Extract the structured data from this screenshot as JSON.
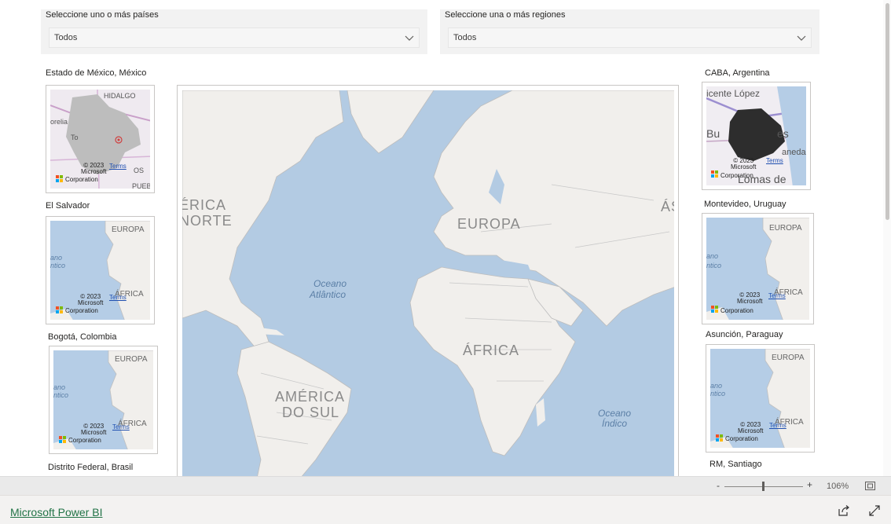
{
  "filters": {
    "countries": {
      "title": "Seleccione uno o más países",
      "value": "Todos"
    },
    "regions": {
      "title": "Seleccione una o más regiones",
      "value": "Todos"
    }
  },
  "visuals": {
    "left": [
      {
        "title": "Estado de México, México",
        "labels": [
          "HIDALGO",
          "orelia",
          "To",
          "OS",
          "PUEB"
        ]
      },
      {
        "title": "El Salvador",
        "labels": [
          "EUROPA",
          "ano",
          "ntico",
          "ÁFRICA"
        ]
      },
      {
        "title": "Bogotá, Colombia",
        "labels": [
          "EUROPA",
          "ano",
          "ntico",
          "ÁFRICA"
        ]
      },
      {
        "title": "Distrito Federal, Brasil"
      }
    ],
    "right": [
      {
        "title": "CABA, Argentina",
        "labels": [
          "icente López",
          "Bu",
          "es",
          "aneda",
          "Lomas de"
        ]
      },
      {
        "title": "Montevideo, Uruguay",
        "labels": [
          "EUROPA",
          "ano",
          "ntico",
          "ÁFRICA"
        ]
      },
      {
        "title": "Asunción, Paraguay",
        "labels": [
          "EUROPA",
          "ano",
          "ntico",
          "ÁFRICA"
        ]
      },
      {
        "title": "RM, Santiago"
      }
    ]
  },
  "map_credits": {
    "copyright": "© 2023",
    "company": "Microsoft",
    "corp": "Corporation",
    "terms": "Terms"
  },
  "main_map": {
    "labels": {
      "na1": "ÉRICA",
      "na2": "NORTE",
      "europe": "EUROPA",
      "asia": "ÁS",
      "africa": "ÁFRICA",
      "sa1": "AMÉRICA",
      "sa2": "DO SUL",
      "atl1": "Oceano",
      "atl2": "Atlântico",
      "ind1": "Oceano",
      "ind2": "Índico"
    }
  },
  "zoom": {
    "minus": "-",
    "plus": "+",
    "percent": "106%"
  },
  "footer": {
    "brand": "Microsoft Power BI"
  }
}
